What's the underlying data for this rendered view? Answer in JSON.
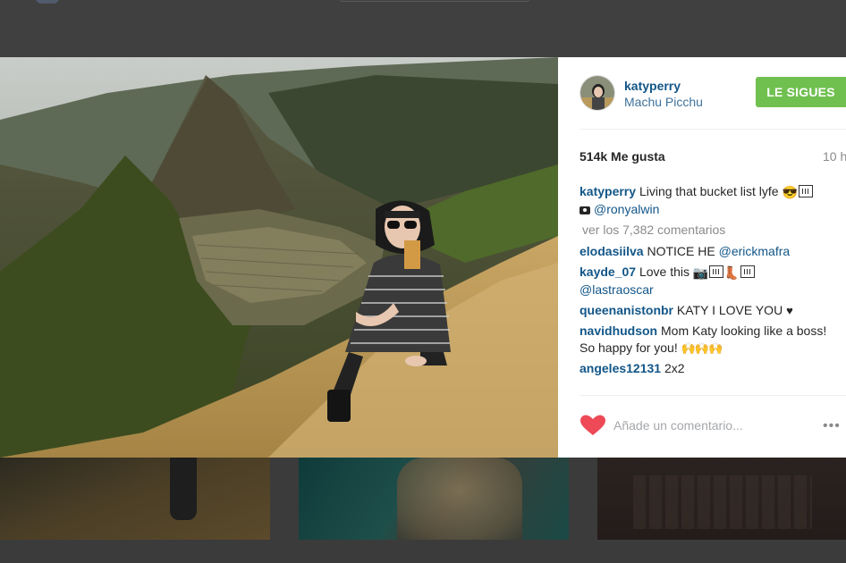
{
  "post": {
    "username": "katyperry",
    "location": "Machu Picchu",
    "follow_label": "LE SIGUES",
    "likes": "514k Me gusta",
    "time": "10 h",
    "photo_alt": "Woman in striped dress and sunglasses posing in front of Machu Picchu ruins",
    "caption": {
      "user": "katyperry",
      "text": "Living that bucket list lyfe",
      "credit": "@ronyalwin"
    },
    "view_all": "ver los 7,382 comentarios",
    "comments": [
      {
        "user": "elodasiilva",
        "text": "NOTICE HE",
        "mention": "@erickmafra"
      },
      {
        "user": "kayde_07",
        "text": "Love this",
        "mention": "@lastraoscar"
      },
      {
        "user": "queenanistonbr",
        "text": "KATY I LOVE YOU"
      },
      {
        "user": "navidhudson",
        "text": "Mom Katy looking like a boss! So happy for you!"
      },
      {
        "user": "angeles12131",
        "text": "2x2"
      }
    ],
    "comment_placeholder": "Añade un comentario...",
    "more_label": "•••"
  },
  "colors": {
    "username_blue": "#125688",
    "location_blue": "#3f729b",
    "follow_green": "#70c050",
    "heart_red": "#ed4956"
  },
  "icons": {
    "like": "heart-icon",
    "more": "more-options-icon",
    "camera": "camera-icon"
  }
}
